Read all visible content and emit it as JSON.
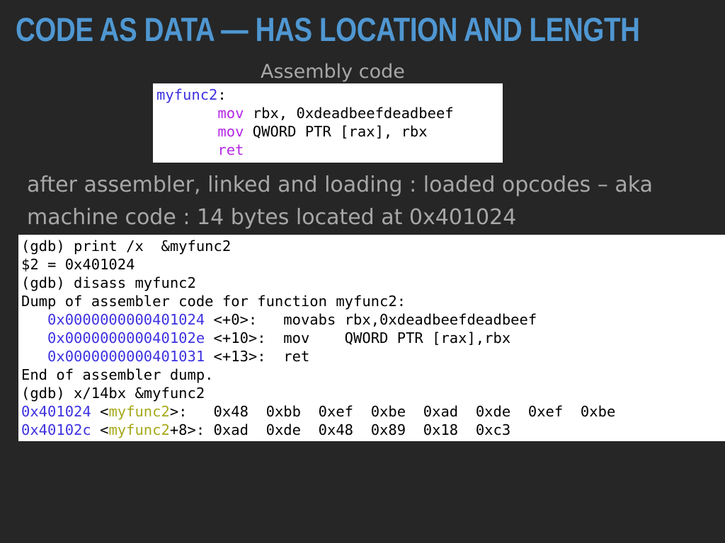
{
  "slide": {
    "title": "CODE AS DATA — HAS LOCATION AND LENGTH",
    "caption": "Assembly code",
    "paragraph_line1": "after assembler, linked and loading : loaded opcodes – aka",
    "paragraph_line2": "machine code : 14 bytes located at 0x401024"
  },
  "colors": {
    "title": "#4f97d2",
    "background": "#262626",
    "caption_text": "#a7a7a7",
    "address_blue": "#3d31e0",
    "mnemonic_purple": "#b528e6",
    "symbol_olive": "#a6a91a"
  },
  "asm": {
    "label": "myfunc2",
    "colon": ":",
    "indent": "       ",
    "line1_op": "mov",
    "line1_args": " rbx, 0xdeadbeefdeadbeef",
    "line2_op": "mov",
    "line2_args": " QWORD PTR [rax], rbx",
    "line3_op": "ret"
  },
  "gdb": {
    "line1": "(gdb) print /x  &myfunc2",
    "line2": "$2 = 0x401024",
    "line3": "(gdb) disass myfunc2",
    "line4": "Dump of assembler code for function myfunc2:",
    "indent": "   ",
    "dis1_addr": "0x0000000000401024",
    "dis1_rest": " <+0>:   movabs rbx,0xdeadbeefdeadbeef",
    "dis2_addr": "0x000000000040102e",
    "dis2_rest": " <+10>:  mov    QWORD PTR [rax],rbx",
    "dis3_addr": "0x0000000000401031",
    "dis3_rest": " <+13>:  ret",
    "line8": "End of assembler dump.",
    "line9": "(gdb) x/14bx &myfunc2",
    "x1_addr": "0x401024",
    "x1_lt": " <",
    "x1_sym": "myfunc2",
    "x1_rest": ">:   0x48  0xbb  0xef  0xbe  0xad  0xde  0xef  0xbe",
    "x2_addr": "0x40102c",
    "x2_lt": " <",
    "x2_sym": "myfunc2",
    "x2_rest": "+8>: 0xad  0xde  0x48  0x89  0x18  0xc3"
  }
}
